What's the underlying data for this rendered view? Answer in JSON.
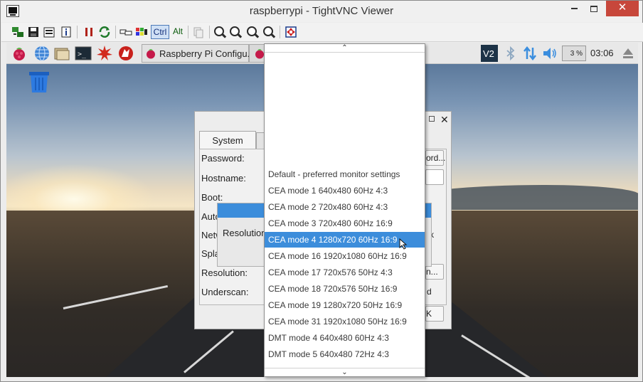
{
  "window": {
    "title": "raspberrypi - TightVNC Viewer",
    "close_glyph": "✕"
  },
  "vnc_toolbar": {
    "icons": [
      "new-connection-icon",
      "save-icon",
      "options-icon",
      "info-icon",
      "pause-icon",
      "refresh-icon",
      "send-cad-icon",
      "send-ctrl-esc-icon"
    ],
    "ctrl_label": "Ctrl",
    "alt_label": "Alt",
    "zoom_icons": [
      "zoom-in-icon",
      "zoom-out-icon",
      "zoom-100-icon",
      "zoom-fit-icon",
      "fullscreen-icon"
    ]
  },
  "pi_panel": {
    "launchers": [
      "raspberry-menu-icon",
      "web-browser-icon",
      "file-manager-icon",
      "terminal-icon",
      "mathematica-icon",
      "wolfram-icon"
    ],
    "task_label": "Raspberry Pi Configu...",
    "cpu_text": "3 %",
    "clock": "03:06",
    "tray": [
      "vnc-server-icon",
      "bluetooth-icon",
      "network-icon",
      "volume-icon",
      "eject-icon"
    ]
  },
  "colors": {
    "selection": "#3c8ddb",
    "close_red": "#c7473b"
  },
  "config_dialog": {
    "tab_system": "System",
    "labels": {
      "password": "Password:",
      "hostname": "Hostname:",
      "boot": "Boot:",
      "auto": "Auto",
      "netw": "Netw",
      "spla": "Spla",
      "resolution": "Resolution:",
      "underscan": "Underscan:"
    },
    "partial_texts": {
      "password_button": "ord...",
      "r_fragment": "r",
      "rk_fragment": "rk",
      "res_button": "n...",
      "d_fragment": "d",
      "ok_fragment": "K"
    },
    "close_glyph": "✕"
  },
  "resolution_popup": {
    "label": "Resolution:"
  },
  "dropdown": {
    "scroll_up": "⌃",
    "scroll_down": "⌄",
    "options": [
      "Default - preferred monitor settings",
      "CEA mode 1 640x480 60Hz 4:3",
      "CEA mode 2 720x480 60Hz 4:3",
      "CEA mode 3 720x480 60Hz 16:9",
      "CEA mode 4 1280x720 60Hz 16:9",
      "CEA mode 16 1920x1080 60Hz 16:9",
      "CEA mode 17 720x576 50Hz 4:3",
      "CEA mode 18 720x576 50Hz 16:9",
      "CEA mode 19 1280x720 50Hz 16:9",
      "CEA mode 31 1920x1080 50Hz 16:9",
      "DMT mode 4 640x480 60Hz 4:3",
      "DMT mode 5 640x480 72Hz 4:3"
    ],
    "highlighted": "CEA mode 4 1280x720 60Hz 16:9"
  }
}
